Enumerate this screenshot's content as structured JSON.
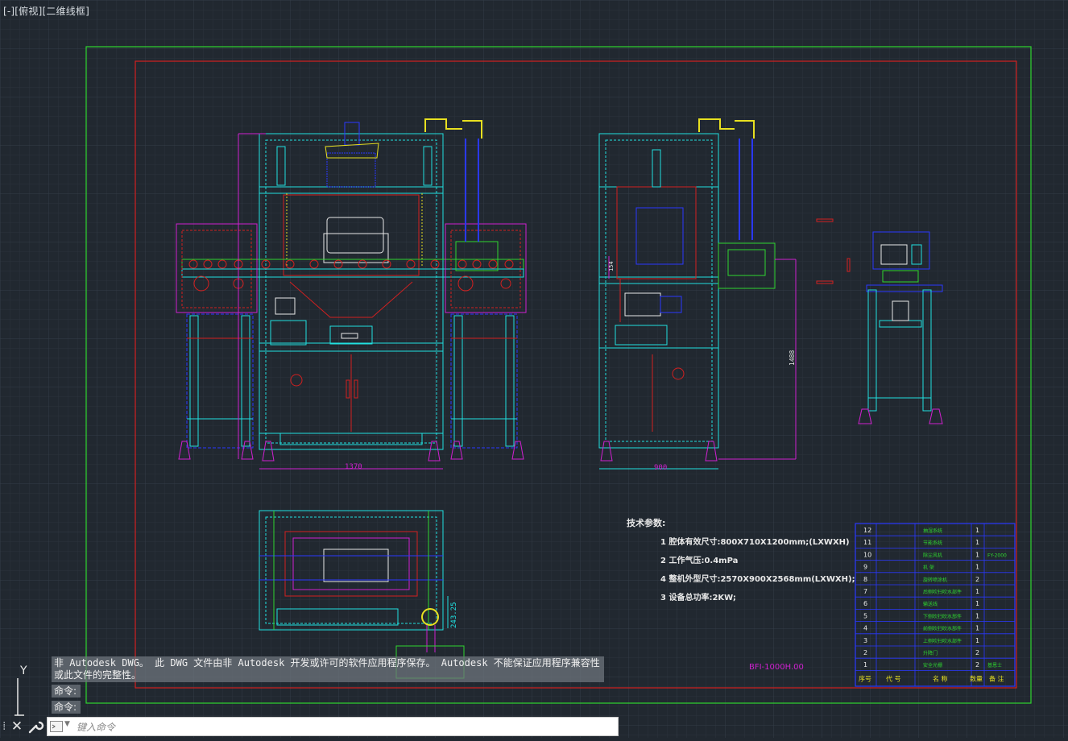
{
  "viewport": {
    "label": "[-][俯视][二维线框]"
  },
  "dims": {
    "width_front": "1370",
    "width_side": "900",
    "height_side": "1488",
    "height_small": "154",
    "top_dim": "243.25"
  },
  "tech": {
    "title": "技术参数:",
    "items": [
      "1 腔体有效尺寸:800X710X1200mm;(LXWXH)",
      "2 工作气压:0.4mPa",
      "4 整机外型尺寸:2570X900X2568mm(LXWXH);",
      "3 设备总功率:2KW;"
    ]
  },
  "drawing_no": "BFI-1000H.00",
  "bom": {
    "rows": [
      {
        "no": "12",
        "name": "抽湿系统",
        "qty": "1",
        "note": ""
      },
      {
        "no": "11",
        "name": "节能系统",
        "qty": "1",
        "note": ""
      },
      {
        "no": "10",
        "name": "除尘风机",
        "qty": "1",
        "note": "FY-2000"
      },
      {
        "no": "9",
        "name": "机 架",
        "qty": "1",
        "note": ""
      },
      {
        "no": "8",
        "name": "旋转喷涂机",
        "qty": "2",
        "note": ""
      },
      {
        "no": "7",
        "name": "后侧吹扫吹水部件",
        "qty": "1",
        "note": ""
      },
      {
        "no": "6",
        "name": "输送线",
        "qty": "1",
        "note": ""
      },
      {
        "no": "5",
        "name": "下侧吹扫吹水部件",
        "qty": "1",
        "note": ""
      },
      {
        "no": "4",
        "name": "前侧吹扫吹水部件",
        "qty": "1",
        "note": ""
      },
      {
        "no": "3",
        "name": "上侧吹扫吹水部件",
        "qty": "1",
        "note": ""
      },
      {
        "no": "2",
        "name": "升降门",
        "qty": "2",
        "note": ""
      },
      {
        "no": "1",
        "name": "安全光栅",
        "qty": "2",
        "note": "基恩士"
      }
    ],
    "header": {
      "no": "序号",
      "code": "代 号",
      "name": "名 称",
      "qty": "数量",
      "note": "备 注"
    }
  },
  "ucs": {
    "y_label": "Y"
  },
  "messages": {
    "warning": "非 Autodesk DWG。  此 DWG 文件由非 Autodesk 开发或许可的软件应用程序保存。  Autodesk 不能保证应用程序兼容性或此文件的完整性。",
    "cmd1": "命令:",
    "cmd2": "命令:"
  },
  "command_line": {
    "placeholder": "键入命令",
    "close_glyph": "✕",
    "grip_glyph": "⁞"
  },
  "colors": {
    "background": "#212830",
    "frame_green": "#2fd62f",
    "frame_red": "#d22020",
    "cyan": "#21e0e0",
    "magenta": "#d020d0",
    "blue": "#2a38ff",
    "yellow": "#e8e020",
    "white": "#e8e8e8"
  }
}
